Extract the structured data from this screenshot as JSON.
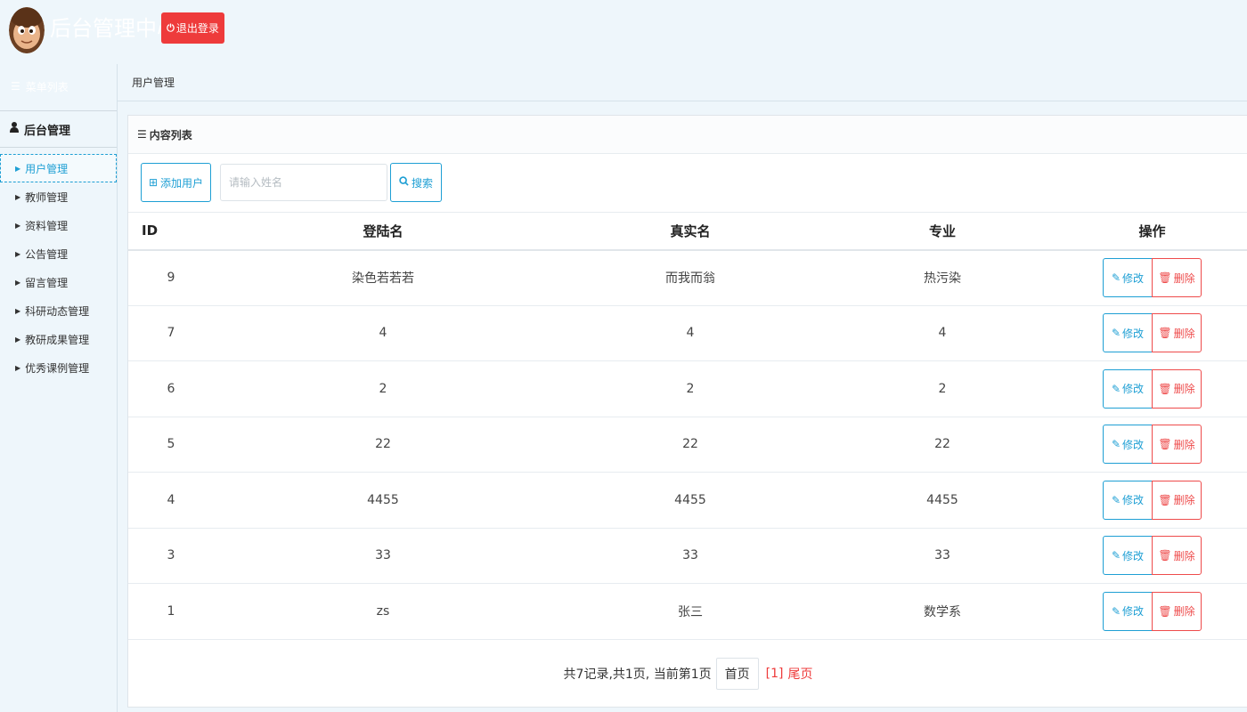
{
  "header": {
    "title": "后台管理中心",
    "logout_label": "退出登录"
  },
  "sidebar": {
    "menu_heading": "菜单列表",
    "group_label": "后台管理",
    "items": [
      {
        "label": "用户管理",
        "active": true
      },
      {
        "label": "教师管理",
        "active": false
      },
      {
        "label": "资料管理",
        "active": false
      },
      {
        "label": "公告管理",
        "active": false
      },
      {
        "label": "留言管理",
        "active": false
      },
      {
        "label": "科研动态管理",
        "active": false
      },
      {
        "label": "教研成果管理",
        "active": false
      },
      {
        "label": "优秀课例管理",
        "active": false
      }
    ]
  },
  "breadcrumb": {
    "current": "用户管理"
  },
  "panel": {
    "title": "内容列表"
  },
  "toolbar": {
    "add_label": "添加用户",
    "search_placeholder": "请输入姓名",
    "search_value": "",
    "search_label": "搜索"
  },
  "table": {
    "headers": {
      "id": "ID",
      "login": "登陆名",
      "real": "真实名",
      "major": "专业",
      "ops": "操作"
    },
    "edit_label": "修改",
    "delete_label": "删除",
    "rows": [
      {
        "id": "9",
        "login": "染色若若若",
        "real": "而我而翁",
        "major": "热污染"
      },
      {
        "id": "7",
        "login": "4",
        "real": "4",
        "major": "4"
      },
      {
        "id": "6",
        "login": "2",
        "real": "2",
        "major": "2"
      },
      {
        "id": "5",
        "login": "22",
        "real": "22",
        "major": "22"
      },
      {
        "id": "4",
        "login": "4455",
        "real": "4455",
        "major": "4455"
      },
      {
        "id": "3",
        "login": "33",
        "real": "33",
        "major": "33"
      },
      {
        "id": "1",
        "login": "zs",
        "real": "张三",
        "major": "数学系"
      }
    ]
  },
  "pager": {
    "summary": "共7记录,共1页, 当前第1页",
    "first_label": "首页",
    "current": "[1]",
    "last_label": "尾页"
  },
  "colors": {
    "accent": "#1e9fd4",
    "danger": "#ee3b3b",
    "background": "#eef6fb"
  },
  "icons": {
    "logout": "power-icon",
    "menu": "menu-icon",
    "user": "user-icon",
    "add": "plus-square-icon",
    "search": "search-icon",
    "edit": "edit-icon",
    "delete": "trash-icon"
  }
}
